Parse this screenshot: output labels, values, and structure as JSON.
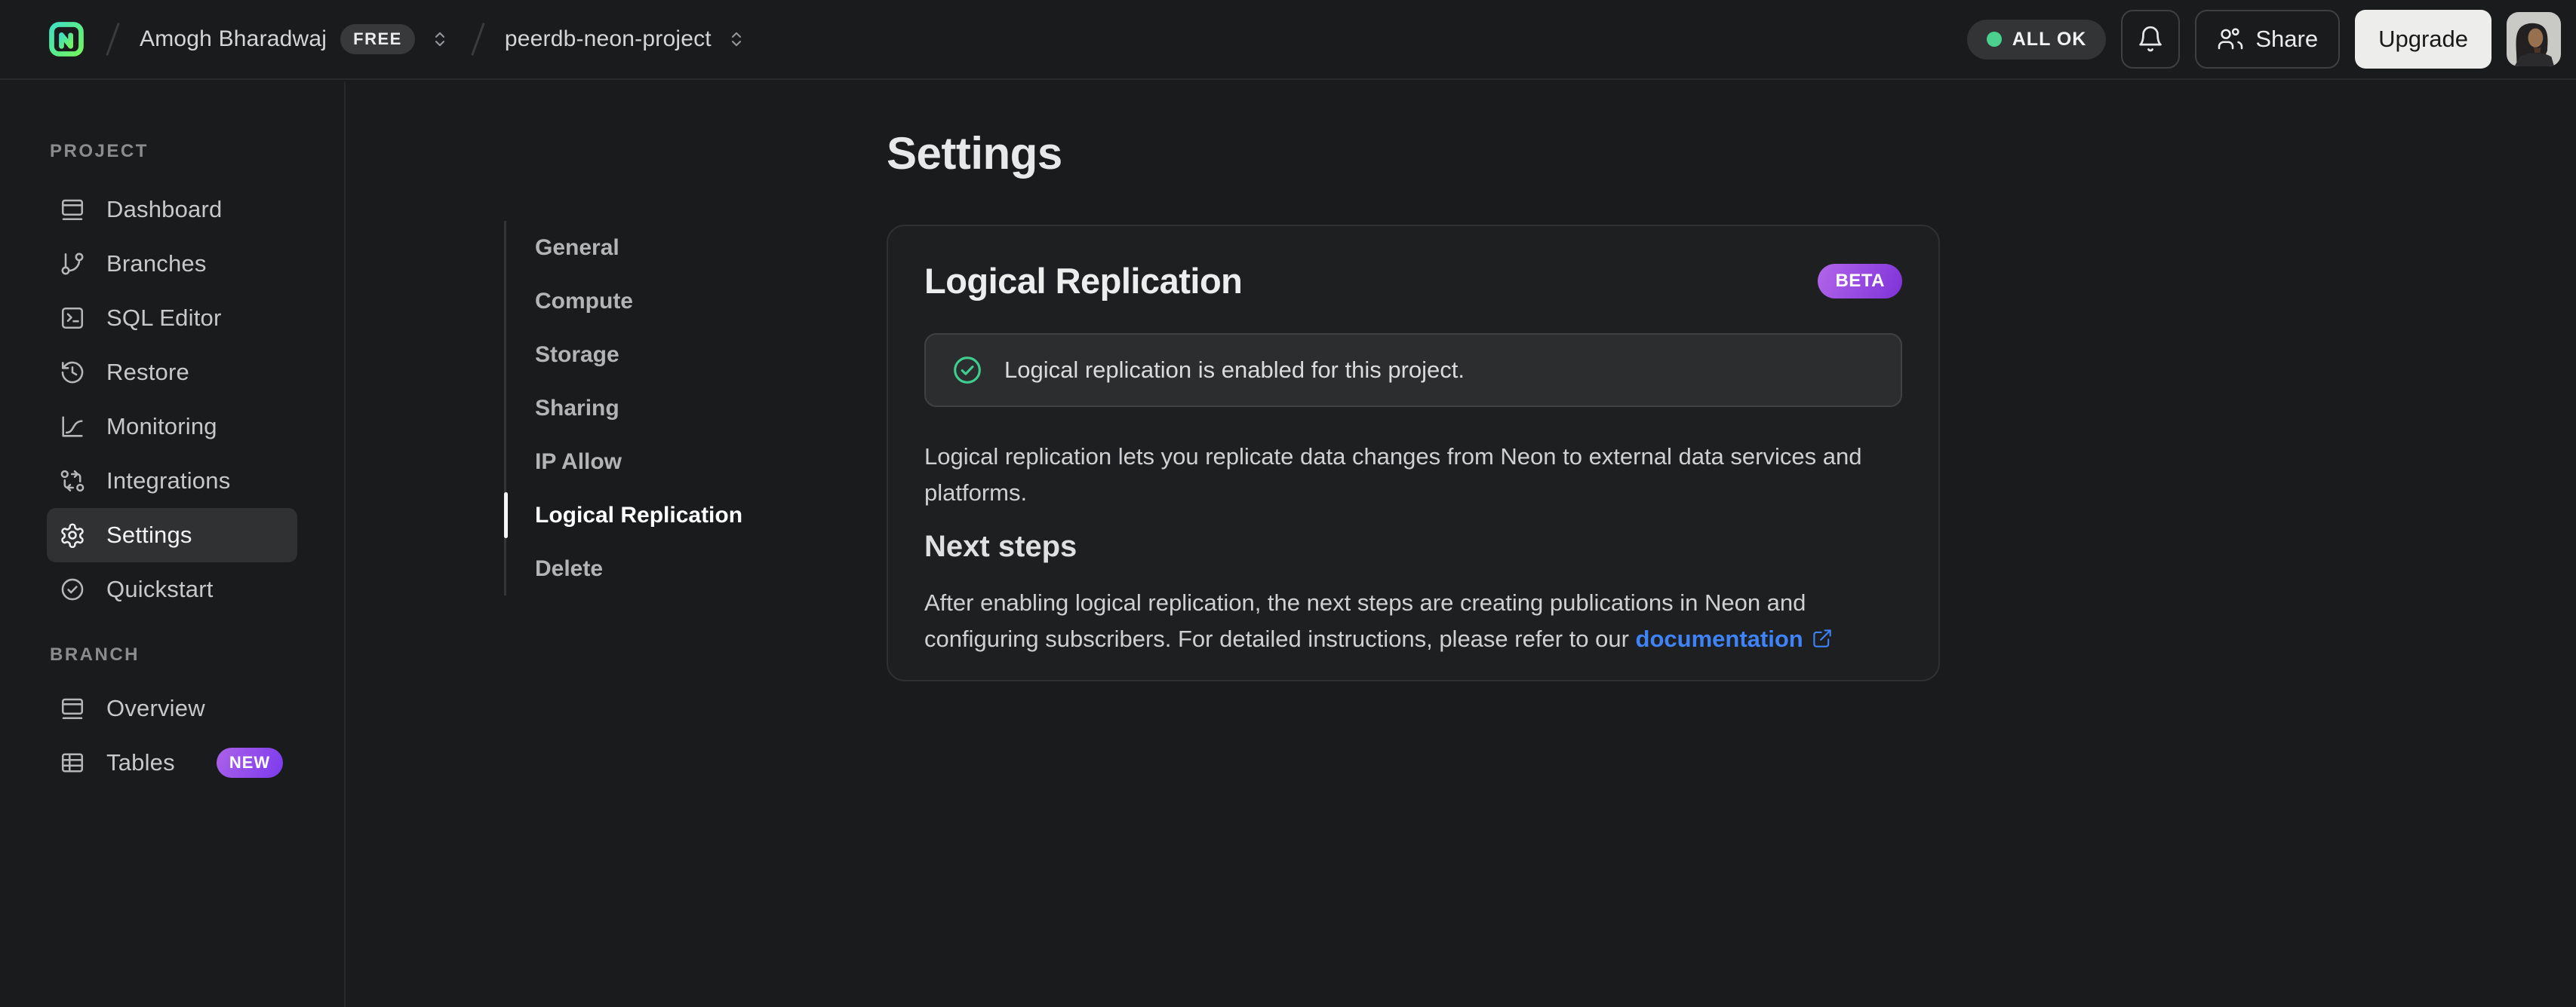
{
  "topbar": {
    "logo_icon": "neon-logo",
    "breadcrumb": {
      "account_name": "Amogh Bharadwaj",
      "plan_badge": "FREE",
      "expander_icon": "chevrons-up-down-icon",
      "project_name": "peerdb-neon-project"
    },
    "status_badge": "ALL OK",
    "notifications_icon": "bell-icon",
    "share_icon": "users-icon",
    "share_label": "Share",
    "upgrade_label": "Upgrade",
    "avatar_icon": "user-avatar"
  },
  "sidebar": {
    "sections": [
      {
        "label": "PROJECT",
        "items": [
          {
            "label": "Dashboard",
            "icon": "dashboard-icon"
          },
          {
            "label": "Branches",
            "icon": "git-branch-icon"
          },
          {
            "label": "SQL Editor",
            "icon": "terminal-icon"
          },
          {
            "label": "Restore",
            "icon": "history-icon"
          },
          {
            "label": "Monitoring",
            "icon": "chart-icon"
          },
          {
            "label": "Integrations",
            "icon": "integrations-icon"
          },
          {
            "label": "Settings",
            "icon": "gear-icon",
            "active": true
          },
          {
            "label": "Quickstart",
            "icon": "check-circle-icon"
          }
        ]
      },
      {
        "label": "BRANCH",
        "items": [
          {
            "label": "Overview",
            "icon": "window-icon"
          },
          {
            "label": "Tables",
            "icon": "table-icon",
            "badge": "NEW"
          }
        ]
      }
    ]
  },
  "settings_nav": {
    "items": [
      {
        "label": "General"
      },
      {
        "label": "Compute"
      },
      {
        "label": "Storage"
      },
      {
        "label": "Sharing"
      },
      {
        "label": "IP Allow"
      },
      {
        "label": "Logical Replication",
        "active": true
      },
      {
        "label": "Delete"
      }
    ]
  },
  "main": {
    "page_title": "Settings",
    "card": {
      "title": "Logical Replication",
      "beta_badge": "BETA",
      "alert_icon": "check-circle-icon",
      "alert_text": "Logical replication is enabled for this project.",
      "description": "Logical replication lets you replicate data changes from Neon to external data services and platforms.",
      "next_steps_title": "Next steps",
      "next_steps_text": "After enabling logical replication, the next steps are creating publications in Neon and configuring subscribers. For detailed instructions, please refer to our ",
      "doc_link_label": "documentation",
      "doc_link_icon": "external-link-icon"
    }
  },
  "colors": {
    "accent_green": "#3ecf8e",
    "status_dot_green": "#4cd08d",
    "badge_purple_start": "#b266ea",
    "badge_purple_end": "#7e32d8",
    "link_blue": "#3e83f8",
    "logo_gradient_start": "#41e0c0",
    "logo_gradient_end": "#71f55e"
  }
}
